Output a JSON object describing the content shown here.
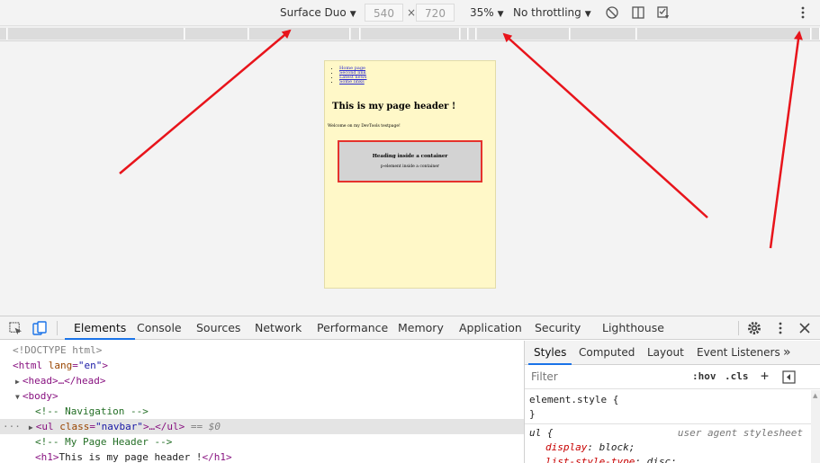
{
  "toolbar": {
    "device": "Surface Duo",
    "width": "540",
    "times": "×",
    "height": "720",
    "zoom": "35%",
    "throttling": "No throttling"
  },
  "page": {
    "nav_links": [
      "Home page",
      "Second link",
      "Latest news",
      "Some links"
    ],
    "header": "This is my page header !",
    "welcome": "Welcome on my DevTools testpage!",
    "container_heading": "Heading inside a container",
    "container_text": "p-element inside a container"
  },
  "devtools": {
    "tabs": [
      "Elements",
      "Console",
      "Sources",
      "Network",
      "Performance",
      "Memory",
      "Application",
      "Security",
      "Lighthouse"
    ],
    "dom": {
      "doctype": "<!DOCTYPE html>",
      "html_open": "<html ",
      "html_attr": "lang",
      "html_val": "\"en\"",
      "html_close": ">",
      "head": "<head>…</head>",
      "body": "<body>",
      "comment_nav": "<!-- Navigation -->",
      "ul_open": "<ul ",
      "ul_attr": "class",
      "ul_val": "\"navbar\"",
      "ul_close": ">…</ul>",
      "ul_marker": " == $0",
      "comment_header": "<!-- My Page Header -->",
      "h1_open": "<h1>",
      "h1_text": "This is my page header !",
      "h1_close": "</h1>"
    },
    "styles_tabs": [
      "Styles",
      "Computed",
      "Layout",
      "Event Listeners"
    ],
    "filter_placeholder": "Filter",
    "hov": ":hov",
    "cls": ".cls",
    "rules": {
      "element_style": "element.style {",
      "close_brace": "}",
      "ul_selector": "ul {",
      "ua_label": "user agent stylesheet",
      "display_prop": "display",
      "display_val": "block;",
      "lst_prop": "list-style-type",
      "lst_val": "disc;"
    }
  },
  "colors": {
    "arrow": "#e8141b",
    "device_bg": "#fff8c8",
    "container_border": "#e5322d",
    "active_tab": "#1a73e8"
  }
}
